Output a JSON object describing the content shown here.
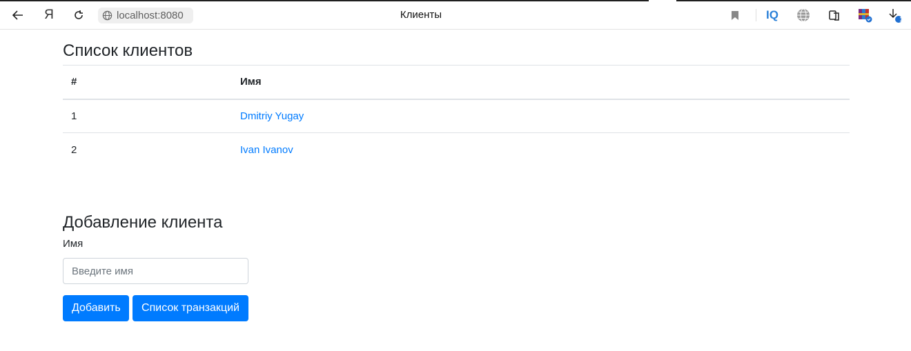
{
  "browser": {
    "url": "localhost:8080",
    "tab_title": "Клиенты",
    "iq_label": "IQ",
    "downloads_badge": "1",
    "ya_label": "Я"
  },
  "clients_section": {
    "title": "Список клиентов",
    "columns": [
      "#",
      "Имя"
    ],
    "rows": [
      {
        "num": "1",
        "name": "Dmitriy Yugay"
      },
      {
        "num": "2",
        "name": "Ivan Ivanov"
      }
    ]
  },
  "add_section": {
    "title": "Добавление клиента",
    "name_label": "Имя",
    "name_placeholder": "Введите имя",
    "add_button": "Добавить",
    "transactions_button": "Список транзакций"
  },
  "colors": {
    "primary": "#007bff",
    "link": "#007bff",
    "text": "#212529"
  }
}
